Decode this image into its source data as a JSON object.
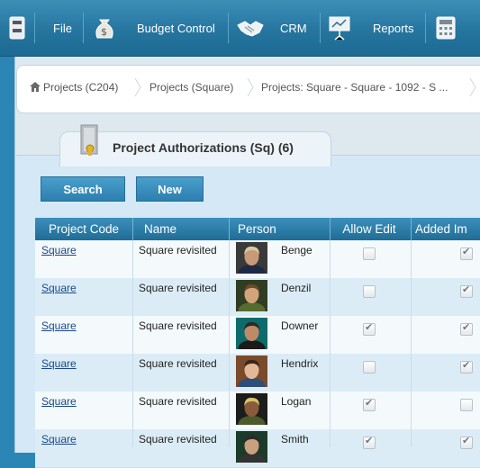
{
  "toolbar": {
    "items": [
      {
        "label": "File",
        "icon": "file-cabinet-icon"
      },
      {
        "label": "Budget Control",
        "icon": "money-bag-icon"
      },
      {
        "label": "CRM",
        "icon": "handshake-icon"
      },
      {
        "label": "Reports",
        "icon": "presentation-board-icon"
      },
      {
        "label": "",
        "icon": "calculator-icon"
      }
    ]
  },
  "breadcrumb": {
    "items": [
      "Projects (C204)",
      "Projects (Square)",
      "Projects: Square - Square - 1092 - S ..."
    ]
  },
  "panel": {
    "title": "Project Authorizations (Sq) (6)",
    "icon": "door-lock-icon"
  },
  "actions": {
    "search": "Search",
    "new": "New"
  },
  "table": {
    "headers": [
      "Project Code",
      "Name",
      "Person",
      "Allow Edit",
      "Added Im"
    ],
    "rows": [
      {
        "code": "Square",
        "name": "Square revisited",
        "person": "Benge",
        "allow_edit": false,
        "added": true
      },
      {
        "code": "Square",
        "name": "Square revisited",
        "person": "Denzil",
        "allow_edit": false,
        "added": true
      },
      {
        "code": "Square",
        "name": "Square revisited",
        "person": "Downer",
        "allow_edit": true,
        "added": true
      },
      {
        "code": "Square",
        "name": "Square revisited",
        "person": "Hendrix",
        "allow_edit": false,
        "added": true
      },
      {
        "code": "Square",
        "name": "Square revisited",
        "person": "Logan",
        "allow_edit": true,
        "added": false
      },
      {
        "code": "Square",
        "name": "Square revisited",
        "person": "Smith",
        "allow_edit": true,
        "added": true
      }
    ]
  },
  "colors": {
    "toolbar": "#25759f",
    "header": "#2c7fae",
    "link": "#1a4a8a"
  }
}
